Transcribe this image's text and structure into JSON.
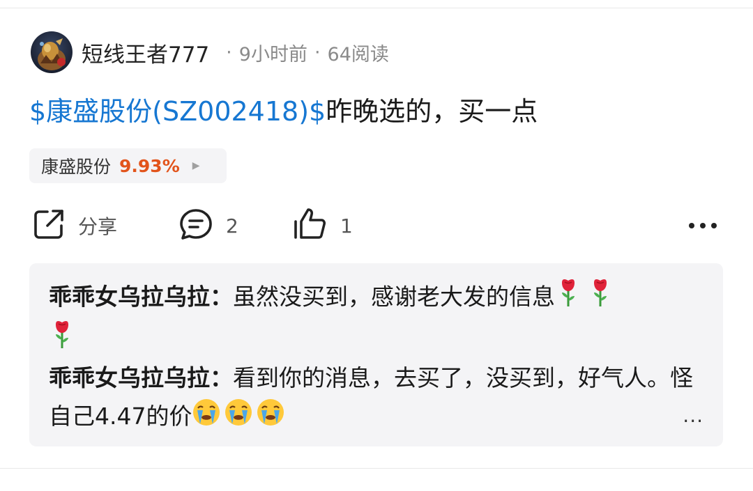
{
  "author": {
    "name": "短线王者777",
    "time": "9小时前",
    "reads": "64阅读",
    "separator": "·"
  },
  "post": {
    "stock_link": "$康盛股份(SZ002418)$",
    "text": "昨晚选的，买一点"
  },
  "stock_chip": {
    "name": "康盛股份",
    "change": "9.93%",
    "change_color": "#e2541b"
  },
  "actions": {
    "share_label": "分享",
    "comment_count": "2",
    "like_count": "1"
  },
  "comments": [
    {
      "name": "乖乖女乌拉乌拉：",
      "text": "虽然没买到，感谢老大发的信息",
      "emoji": "rose"
    },
    {
      "name": "乖乖女乌拉乌拉：",
      "text": "看到你的消息，去买了，没买到，好气人。怪自己4.47的价",
      "emoji": "crying-face"
    }
  ],
  "comments_more": "...",
  "colors": {
    "link": "#1677d2",
    "background_panel": "#f4f4f6"
  }
}
